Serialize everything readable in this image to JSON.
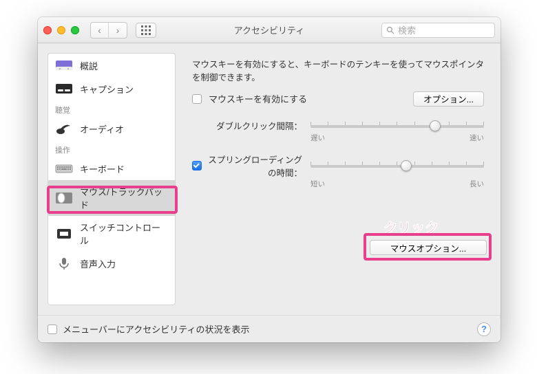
{
  "window": {
    "title": "アクセシビリティ",
    "search_placeholder": "検索"
  },
  "sidebar": {
    "items": [
      {
        "key": "general",
        "label": "概説"
      },
      {
        "key": "captions",
        "label": "キャプション"
      }
    ],
    "group_hearing": "聴覚",
    "hearing_items": [
      {
        "key": "audio",
        "label": "オーディオ"
      }
    ],
    "group_interact": "操作",
    "interact_items": [
      {
        "key": "keyboard",
        "label": "キーボード"
      },
      {
        "key": "mouse",
        "label": "マウス/トラックパッド"
      },
      {
        "key": "switch",
        "label": "スイッチコントロール"
      },
      {
        "key": "dictation",
        "label": "音声入力"
      }
    ]
  },
  "panel": {
    "desc": "マウスキーを有効にすると、キーボードのテンキーを使ってマウスポインタを制御できます。",
    "mousekeys_label": "マウスキーを有効にする",
    "options_btn": "オプション...",
    "double_click_label": "ダブルクリック間隔：",
    "double_click_slow": "遅い",
    "double_click_fast": "速い",
    "spring_label": "スプリングローディングの時間：",
    "spring_short": "短い",
    "spring_long": "長い",
    "mouse_option_btn": "マウスオプション...",
    "annotation": "クリック"
  },
  "footer": {
    "menubar_label": "メニューバーにアクセシビリティの状況を表示"
  }
}
